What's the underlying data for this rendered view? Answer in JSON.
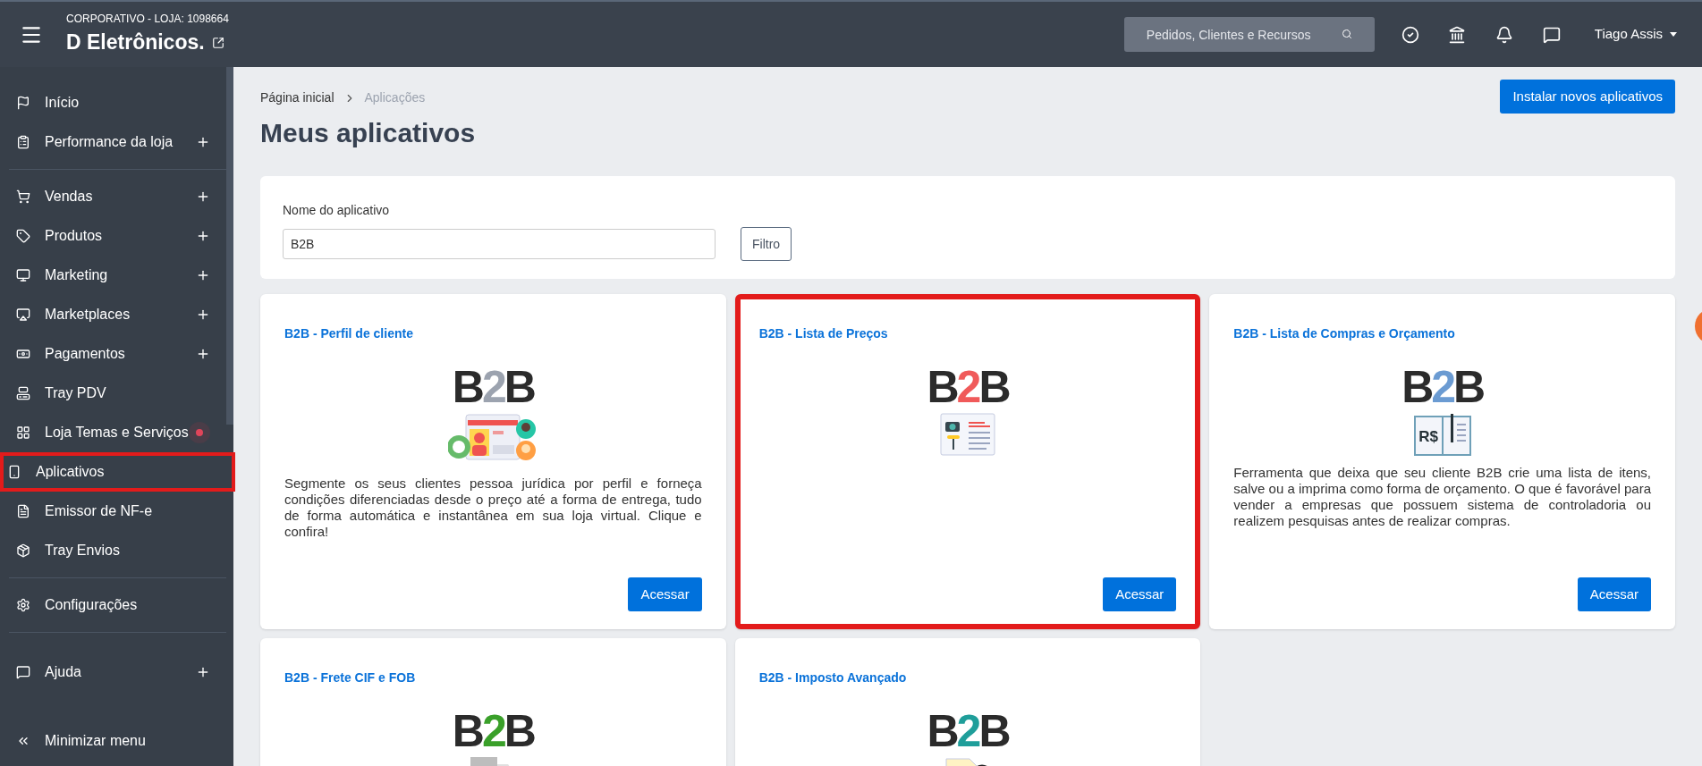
{
  "top_bar": {
    "store_label": "CORPORATIVO - LOJA: 1098664",
    "store_name": "D Eletrônicos.",
    "search": {
      "placeholder": "Pedidos, Clientes e Recursos"
    },
    "user": "Tiago Assis"
  },
  "sidebar": {
    "groups": [
      {
        "items": [
          {
            "label": "Início",
            "expandable": false,
            "badge": false,
            "highlighted": false
          },
          {
            "label": "Performance da loja",
            "expandable": true,
            "badge": false,
            "highlighted": false
          }
        ]
      },
      {
        "items": [
          {
            "label": "Vendas",
            "expandable": true,
            "badge": false,
            "highlighted": false
          },
          {
            "label": "Produtos",
            "expandable": true,
            "badge": false,
            "highlighted": false
          },
          {
            "label": "Marketing",
            "expandable": true,
            "badge": false,
            "highlighted": false
          },
          {
            "label": "Marketplaces",
            "expandable": true,
            "badge": false,
            "highlighted": false
          },
          {
            "label": "Pagamentos",
            "expandable": true,
            "badge": false,
            "highlighted": false
          },
          {
            "label": "Tray PDV",
            "expandable": false,
            "badge": false,
            "highlighted": false
          },
          {
            "label": "Loja Temas e Serviços",
            "expandable": false,
            "badge": true,
            "highlighted": false
          },
          {
            "label": "Aplicativos",
            "expandable": false,
            "badge": false,
            "highlighted": true
          },
          {
            "label": "Emissor de NF-e",
            "expandable": false,
            "badge": false,
            "highlighted": false
          },
          {
            "label": "Tray Envios",
            "expandable": false,
            "badge": false,
            "highlighted": false
          }
        ]
      },
      {
        "items": [
          {
            "label": "Configurações",
            "expandable": false,
            "badge": false,
            "highlighted": false
          }
        ]
      },
      {
        "items": [
          {
            "label": "Ajuda",
            "expandable": true,
            "badge": false,
            "highlighted": false
          }
        ]
      }
    ],
    "minimize": "Minimizar menu"
  },
  "breadcrumb": [
    "Página inicial",
    "Aplicações"
  ],
  "page_title": "Meus aplicativos",
  "install_button": "Instalar novos aplicativos",
  "filter": {
    "label": "Nome do aplicativo",
    "value": "B2B",
    "button": "Filtro"
  },
  "apps": [
    {
      "title": "B2B - Perfil de cliente",
      "logo": {
        "parts": [
          "B",
          "2",
          "B"
        ],
        "color": "#9ca3af"
      },
      "kind": "profile",
      "description": "Segmente os seus clientes pessoa jurídica por perfil e forneça condições diferenciadas desde o preço até a forma de entrega, tudo de forma automática e instantânea em sua loja virtual. Clique e confira!",
      "button": "Acessar",
      "highlighted": false
    },
    {
      "title": "B2B - Lista de Preços",
      "logo": {
        "parts": [
          "B",
          "2",
          "B"
        ],
        "color": "#f05a5a"
      },
      "kind": "price-list",
      "button": "Acessar",
      "highlighted": true
    },
    {
      "title": "B2B - Lista de Compras e Orçamento",
      "logo": {
        "parts": [
          "B",
          "2",
          "B"
        ],
        "color": "#6b9bd2"
      },
      "kind": "budget",
      "illustration_text": "R$",
      "description": "Ferramenta que deixa que seu cliente B2B crie uma lista de itens, salve ou a imprima como forma de orçamento. O que é favorável para vender a empresas que possuem sistema de controladoria ou realizem pesquisas antes de realizar compras.",
      "button": "Acessar",
      "highlighted": false
    },
    {
      "title": "B2B - Frete CIF e FOB",
      "logo": {
        "parts": [
          "B",
          "2",
          "B"
        ],
        "color": "#3aa02a"
      },
      "kind": "truck",
      "highlighted": false
    },
    {
      "title": "B2B - Imposto Avançado",
      "logo": {
        "parts": [
          "B",
          "2",
          "B"
        ],
        "color": "#1f9e9a"
      },
      "kind": "document",
      "highlighted": false
    }
  ]
}
